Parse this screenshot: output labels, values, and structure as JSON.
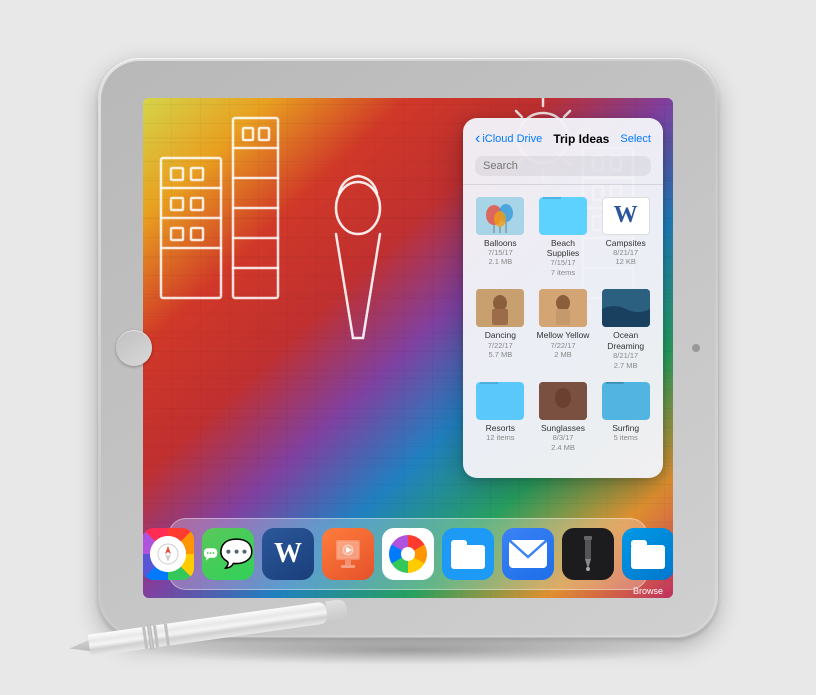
{
  "scene": {
    "bg_color": "#e0e0e0"
  },
  "panel": {
    "back_label": "iCloud Drive",
    "title": "Trip Ideas",
    "select_label": "Select",
    "search_placeholder": "Search",
    "files": [
      {
        "id": "balloons",
        "name": "Balloons",
        "date": "7/15/17",
        "size": "2.1 MB",
        "type": "thumb"
      },
      {
        "id": "beach-supplies",
        "name": "Beach Supplies",
        "date": "7/15/17",
        "size": "7 items",
        "type": "folder"
      },
      {
        "id": "campsites",
        "name": "Campsites",
        "date": "8/21/17",
        "size": "12 KB",
        "type": "word"
      },
      {
        "id": "dancing",
        "name": "Dancing",
        "date": "7/22/17",
        "size": "5.7 MB",
        "type": "thumb"
      },
      {
        "id": "mellow-yellow",
        "name": "Mellow Yellow",
        "date": "7/22/17",
        "size": "2 MB",
        "type": "thumb"
      },
      {
        "id": "ocean-dreaming",
        "name": "Ocean Dreaming",
        "date": "8/21/17",
        "size": "2.7 MB",
        "type": "thumb"
      },
      {
        "id": "resorts",
        "name": "Resorts",
        "date": "",
        "size": "12 items",
        "type": "folder"
      },
      {
        "id": "sunglasses",
        "name": "Sunglasses",
        "date": "8/3/17",
        "size": "2.4 MB",
        "type": "thumb"
      },
      {
        "id": "surfing",
        "name": "Surfing",
        "date": "",
        "size": "5 items",
        "type": "folder"
      }
    ]
  },
  "dock": {
    "items": [
      {
        "id": "safari",
        "label": "Safari"
      },
      {
        "id": "messages",
        "label": "Messages"
      },
      {
        "id": "word",
        "label": "Word"
      },
      {
        "id": "keynote",
        "label": "Keynote"
      },
      {
        "id": "photos",
        "label": "Photos"
      },
      {
        "id": "files",
        "label": "Files"
      },
      {
        "id": "mail",
        "label": "Mail"
      },
      {
        "id": "ink",
        "label": "Ink"
      },
      {
        "id": "browse",
        "label": "Browse"
      }
    ],
    "browse_label": "Browse"
  }
}
